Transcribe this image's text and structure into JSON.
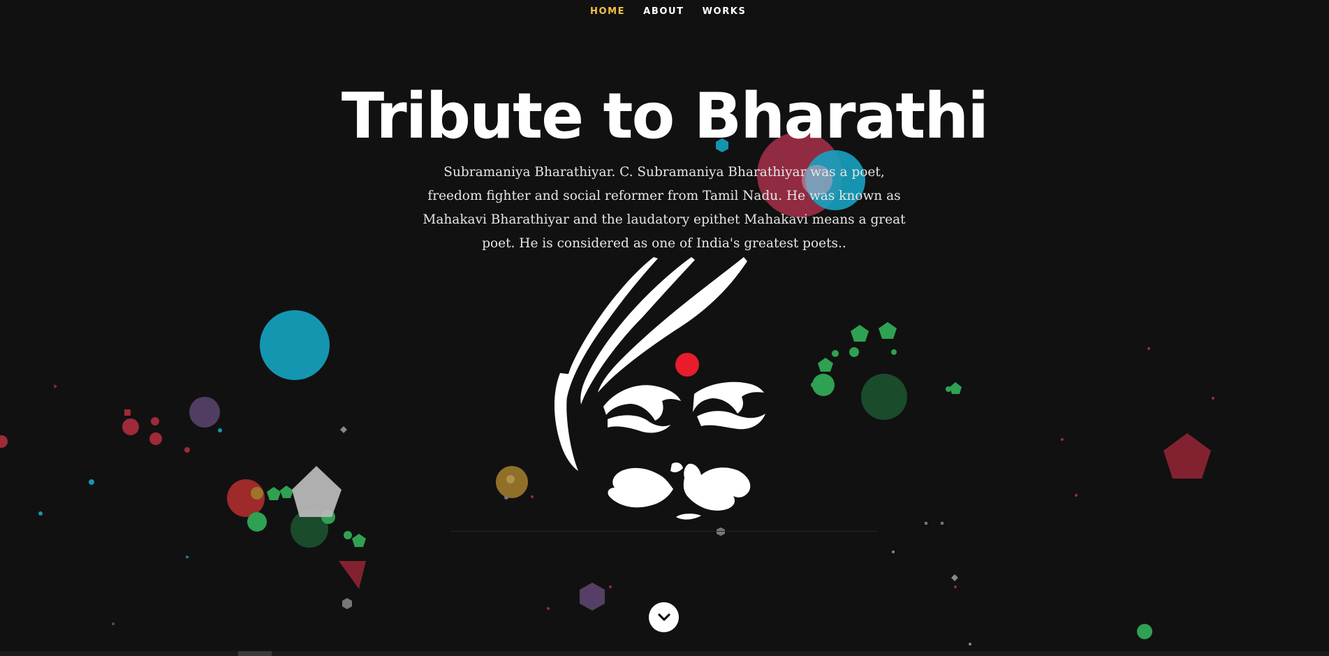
{
  "nav": {
    "items": [
      {
        "label": "HOME",
        "active": true
      },
      {
        "label": "ABOUT",
        "active": false
      },
      {
        "label": "WORKS",
        "active": false
      }
    ],
    "active_color": "#f6c244"
  },
  "hero": {
    "title": "Tribute to Bharathi",
    "description": "Subramaniya Bharathiyar. C. Subramaniya Bharathiyar was a poet, freedom fighter and social reformer from Tamil Nadu. He was known as Mahakavi Bharathiyar and the laudatory epithet Mahakavi means a great poet. He is considered as one of India's greatest poets..",
    "portrait_icon": "bharathi-portrait-icon",
    "scroll_icon": "chevron-down-icon"
  },
  "colors": {
    "background": "#111112",
    "red": "#9e2a3a",
    "teal": "#1596b0",
    "green": "#2fa152",
    "gray": "#b8b8b8",
    "purple": "#5d4570",
    "gold": "#9f7b2c",
    "bindi": "#e81c2a"
  }
}
